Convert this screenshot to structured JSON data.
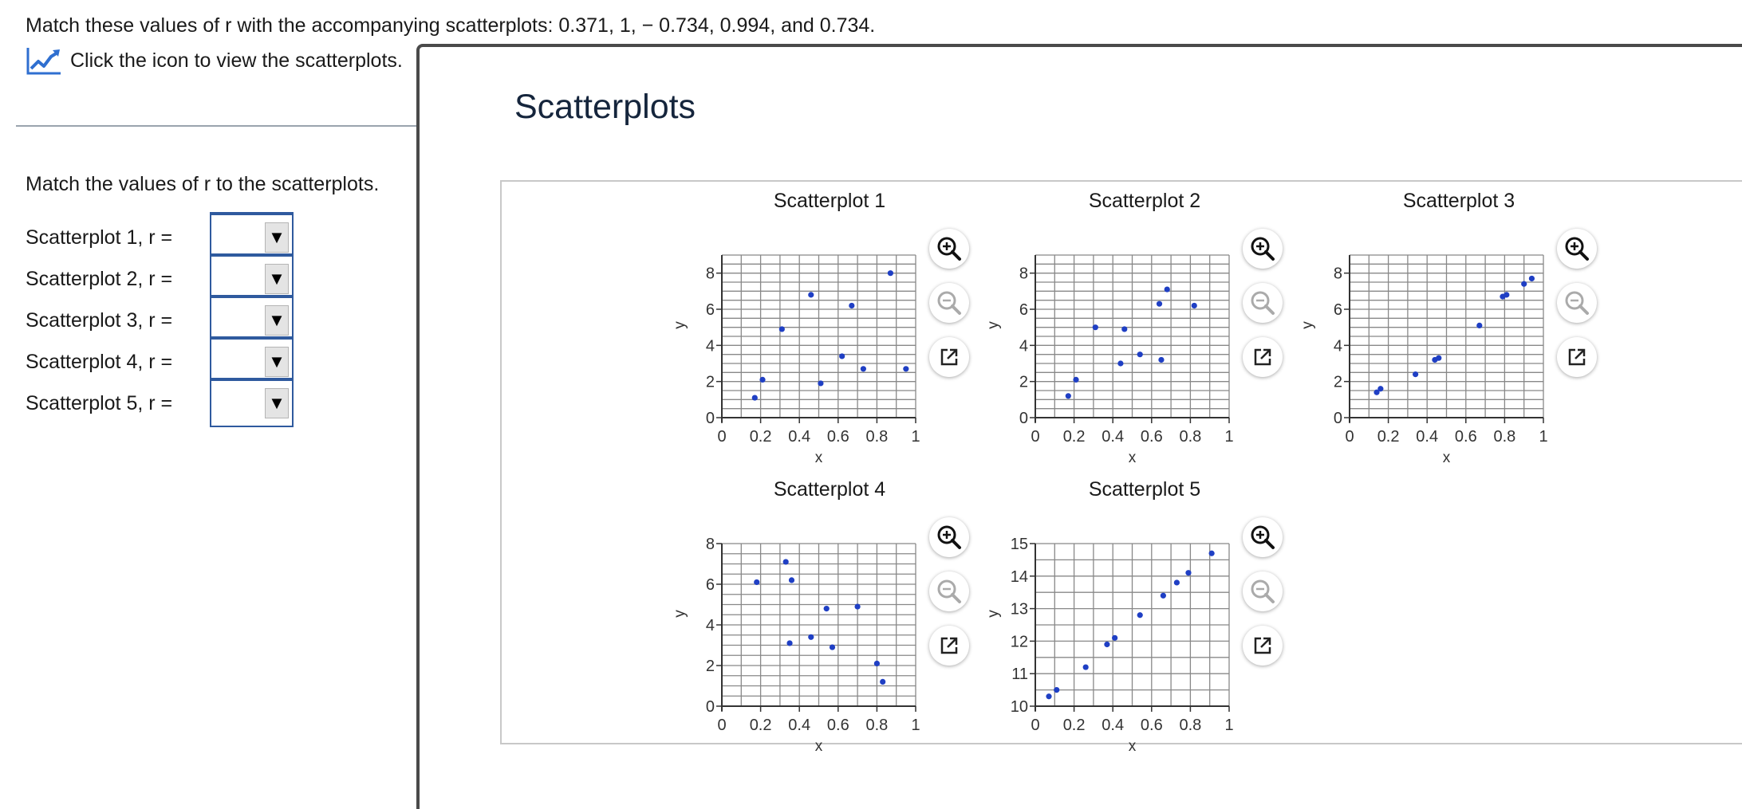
{
  "question": "Match these values of r with the accompanying scatterplots: 0.371, 1,  − 0.734, 0.994, and 0.734.",
  "help_link": {
    "text": "Click the icon to view the scatterplots.",
    "icon": "line-chart-icon"
  },
  "instruction": "Match the values of r to the scatterplots.",
  "answers": [
    {
      "label": "Scatterplot 1, r =",
      "value": ""
    },
    {
      "label": "Scatterplot 2, r =",
      "value": ""
    },
    {
      "label": "Scatterplot 3, r =",
      "value": ""
    },
    {
      "label": "Scatterplot 4, r =",
      "value": ""
    },
    {
      "label": "Scatterplot 5, r =",
      "value": ""
    }
  ],
  "panel": {
    "title": "Scatterplots",
    "tools": [
      "zoom-in-icon",
      "zoom-out-icon",
      "popout-icon"
    ]
  },
  "colors": {
    "point": "#1f3fc4",
    "grid": "#888888",
    "link_blue": "#2f5a9e"
  },
  "chart_data": [
    {
      "type": "scatter",
      "title": "Scatterplot 1",
      "xlabel": "x",
      "ylabel": "y",
      "xlim": [
        0,
        1
      ],
      "ylim": [
        0,
        9
      ],
      "xticks": [
        "0",
        "0.2",
        "0.4",
        "0.6",
        "0.8",
        "1"
      ],
      "yticks": [
        "0",
        "2",
        "4",
        "6",
        "8"
      ],
      "x": [
        0.17,
        0.21,
        0.31,
        0.46,
        0.51,
        0.62,
        0.67,
        0.73,
        0.87,
        0.95
      ],
      "y": [
        1.1,
        2.1,
        4.9,
        6.8,
        1.9,
        3.4,
        6.2,
        2.7,
        8.0,
        2.7
      ]
    },
    {
      "type": "scatter",
      "title": "Scatterplot 2",
      "xlabel": "x",
      "ylabel": "y",
      "xlim": [
        0,
        1
      ],
      "ylim": [
        0,
        9
      ],
      "xticks": [
        "0",
        "0.2",
        "0.4",
        "0.6",
        "0.8",
        "1"
      ],
      "yticks": [
        "0",
        "2",
        "4",
        "6",
        "8"
      ],
      "x": [
        0.17,
        0.21,
        0.31,
        0.44,
        0.46,
        0.54,
        0.64,
        0.65,
        0.68,
        0.82
      ],
      "y": [
        1.2,
        2.1,
        5.0,
        3.0,
        4.9,
        3.5,
        6.3,
        3.2,
        7.1,
        6.2
      ]
    },
    {
      "type": "scatter",
      "title": "Scatterplot 3",
      "xlabel": "x",
      "ylabel": "y",
      "xlim": [
        0,
        1
      ],
      "ylim": [
        0,
        9
      ],
      "xticks": [
        "0",
        "0.2",
        "0.4",
        "0.6",
        "0.8",
        "1"
      ],
      "yticks": [
        "0",
        "2",
        "4",
        "6",
        "8"
      ],
      "x": [
        0.14,
        0.16,
        0.34,
        0.44,
        0.46,
        0.67,
        0.79,
        0.81,
        0.9,
        0.94
      ],
      "y": [
        1.4,
        1.6,
        2.4,
        3.2,
        3.3,
        5.1,
        6.7,
        6.8,
        7.4,
        7.7
      ]
    },
    {
      "type": "scatter",
      "title": "Scatterplot 4",
      "xlabel": "x",
      "ylabel": "y",
      "xlim": [
        0,
        1
      ],
      "ylim": [
        0,
        8
      ],
      "xticks": [
        "0",
        "0.2",
        "0.4",
        "0.6",
        "0.8",
        "1"
      ],
      "yticks": [
        "0",
        "2",
        "4",
        "6",
        "8"
      ],
      "x": [
        0.18,
        0.33,
        0.35,
        0.36,
        0.46,
        0.54,
        0.57,
        0.7,
        0.8,
        0.83
      ],
      "y": [
        6.1,
        7.1,
        3.1,
        6.2,
        3.4,
        4.8,
        2.9,
        4.9,
        2.1,
        1.2
      ]
    },
    {
      "type": "scatter",
      "title": "Scatterplot 5",
      "xlabel": "x",
      "ylabel": "y",
      "xlim": [
        0,
        1
      ],
      "ylim": [
        10,
        15
      ],
      "xticks": [
        "0",
        "0.2",
        "0.4",
        "0.6",
        "0.8",
        "1"
      ],
      "yticks": [
        "10",
        "11",
        "12",
        "13",
        "14",
        "15"
      ],
      "x": [
        0.07,
        0.11,
        0.26,
        0.37,
        0.41,
        0.54,
        0.66,
        0.73,
        0.79,
        0.91
      ],
      "y": [
        10.3,
        10.5,
        11.2,
        11.9,
        12.1,
        12.8,
        13.4,
        13.8,
        14.1,
        14.7
      ]
    }
  ]
}
